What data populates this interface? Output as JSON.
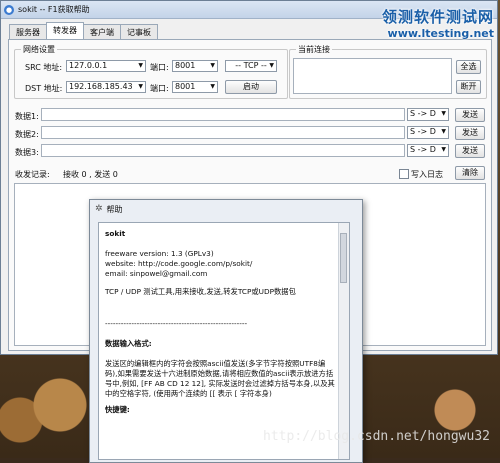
{
  "window": {
    "title": "sokit -- F1获取帮助"
  },
  "tabs": [
    "服务器",
    "转发器",
    "客户端",
    "记事板"
  ],
  "network": {
    "legend": "网络设置",
    "src_label": "SRC 地址:",
    "src_addr": "127.0.0.1",
    "port_label": "端口:",
    "src_port": "8001",
    "dst_label": "DST 地址:",
    "dst_addr": "192.168.185.43",
    "dst_port": "8001",
    "protocol": "-- TCP --",
    "start_button": "启动"
  },
  "connections": {
    "legend": "当前连接",
    "select_all": "全选",
    "disconnect": "断开"
  },
  "data_rows": [
    {
      "label": "数据1:",
      "direction": "S -> D",
      "send": "发送"
    },
    {
      "label": "数据2:",
      "direction": "S -> D",
      "send": "发送"
    },
    {
      "label": "数据3:",
      "direction": "S -> D",
      "send": "发送"
    }
  ],
  "log": {
    "label": "收发记录:",
    "stats": "接收 0 , 发送 0",
    "write_log": "写入日志",
    "clear": "清除"
  },
  "help": {
    "title": "帮助",
    "app_name": "sokit",
    "version": "freeware version: 1.3 (GPLv3)",
    "website": "website: http://code.google.com/p/sokit/",
    "email": "email: sinpowel@gmail.com",
    "desc": "TCP / UDP 测试工具,用来接收,发送,转发TCP或UDP数据包",
    "divider": "------------------------------------------------------",
    "format_heading": "数据输入格式:",
    "format_text": "发送区的编辑框内的字符会按照ascii值发送(多字节字符按照UTF8编码),如果需要发送十六进制原始数据,请将相应数值的ascii表示放进方括号中,例如, [FF AB CD 12 12], 实际发送时会过滤掉方括号本身,以及其中的空格字符, (使用两个连续的 [[ 表示 [ 字符本身)",
    "shortcut_heading": "快捷键:"
  },
  "watermark": {
    "site_cn": "领测软件测试网",
    "site_en": "www.ltesting.net",
    "blog": "http://blog.csdn.net/hongwu32"
  }
}
